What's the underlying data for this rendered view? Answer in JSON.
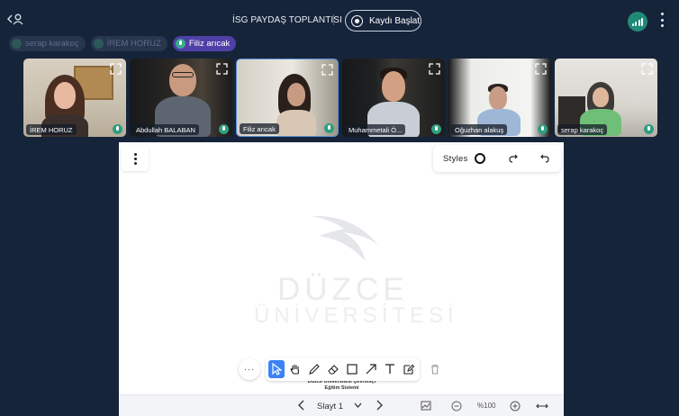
{
  "meeting": {
    "title": "İSG PAYDAŞ TOPLANTISI",
    "record_label": "Kaydı Başlat"
  },
  "speaking_chips": [
    {
      "name": "serap karakoç",
      "active": false
    },
    {
      "name": "İREM HORUZ",
      "active": false
    },
    {
      "name": "Filiz arıcak",
      "active": true
    }
  ],
  "participants": [
    {
      "name": "İREM HORUZ",
      "speaking": false
    },
    {
      "name": "Abdullah BALABAN",
      "speaking": false
    },
    {
      "name": "Filiz arıcak",
      "speaking": true
    },
    {
      "name": "Muhammetali Ö...",
      "speaking": false
    },
    {
      "name": "Oğuzhan alakuş",
      "speaking": false
    },
    {
      "name": "serap karakoç",
      "speaking": false
    }
  ],
  "whiteboard": {
    "styles_label": "Styles",
    "logo_line1": "DÜZCE",
    "logo_line2": "ÜNİVERSİTESİ",
    "slide_caption_line1": "Düzce Üniversitesi Çevrimiçi",
    "slide_caption_line2": "Eğitim Sistemi",
    "more_label": "···"
  },
  "slide_nav": {
    "slide_label": "Slayt 1",
    "zoom_level": "%100"
  },
  "colors": {
    "background": "#16243a",
    "accent_purple": "#4f3fa6",
    "signal_green": "#1f8a76",
    "tool_selected": "#3b82f6"
  },
  "icons": {
    "user_toggle": "user-arrow-icon",
    "record": "record-icon",
    "signal": "signal-bars-icon",
    "menu": "vertical-dots-icon"
  }
}
